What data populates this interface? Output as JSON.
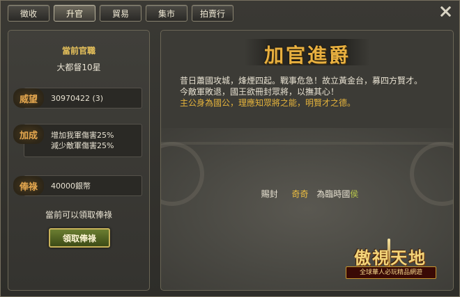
{
  "tabs": [
    {
      "label": "徵收",
      "active": false
    },
    {
      "label": "升官",
      "active": true
    },
    {
      "label": "貿易",
      "active": false
    },
    {
      "label": "集市",
      "active": false
    },
    {
      "label": "拍賣行",
      "active": false
    }
  ],
  "left": {
    "title": "當前官職",
    "rank": "大都督10星",
    "stats": [
      {
        "label": "威望",
        "value_lines": [
          "30970422 (3)"
        ]
      },
      {
        "label": "加成",
        "value_lines": [
          "增加我軍傷害25%",
          "減少敵軍傷害25%"
        ]
      },
      {
        "label": "俸祿",
        "value_lines": [
          "40000銀幣"
        ]
      }
    ],
    "notice": "當前可以領取俸祿",
    "claim_button": "領取俸祿"
  },
  "right": {
    "banner": "加官進爵",
    "desc_line1": "昔日蕭國攻城，烽煙四起。戰事危急！故立黃金台，募四方賢才。",
    "desc_line2": "今敵軍敗退，國王欲冊封眾將，以撫其心！",
    "desc_line3": "主公身為國公，理應知眾將之能，明賢才之德。",
    "award": {
      "prefix": "賜封",
      "name": "奇奇",
      "text": "為臨時國",
      "title": "侯"
    }
  },
  "logo": {
    "title": "傲視天地",
    "subtitle": "全球華人必玩精品網遊"
  },
  "colors": {
    "gold": "#e8b040",
    "label_orange": "#e6a84f",
    "highlight_yellow": "#f0c040",
    "accent_green": "#b7c64a"
  }
}
